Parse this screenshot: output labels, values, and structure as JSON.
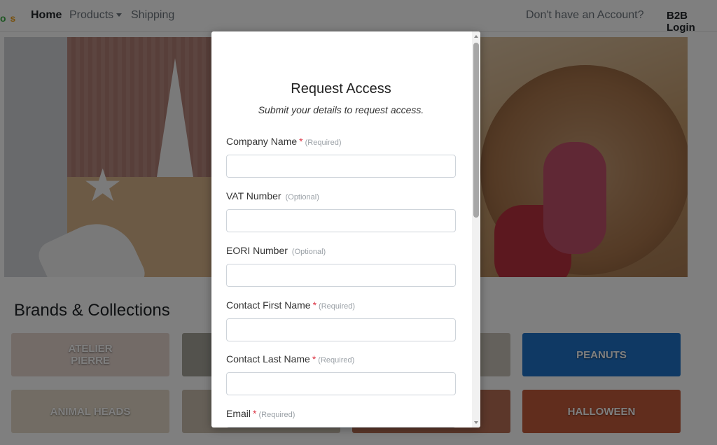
{
  "nav": {
    "logo_o": "o",
    "logo_s": "s",
    "home": "Home",
    "products": "Products",
    "shipping": "Shipping",
    "no_account": "Don't have an Account?",
    "login": "B2B Login"
  },
  "brands": {
    "title": "Brands & Collections",
    "tiles": [
      {
        "label": "ATELIER\nPIERRE",
        "color": "#e6d6cf"
      },
      {
        "label": "",
        "color": "#a7a59b"
      },
      {
        "label": "",
        "color": "#c9c3b8"
      },
      {
        "label": "PEANUTS",
        "color": "#1f73c9"
      },
      {
        "label": "ANIMAL HEADS",
        "color": "#e4d9c8"
      },
      {
        "label": "",
        "color": "#cbbfae"
      },
      {
        "label": "",
        "color": "#b96e55"
      },
      {
        "label": "HALLOWEEN",
        "color": "#c35a3a"
      }
    ]
  },
  "modal": {
    "title": "Request Access",
    "subtitle": "Submit your details to request access.",
    "fields": [
      {
        "label": "Company Name",
        "required": "*",
        "hint": "(Required)"
      },
      {
        "label": "VAT Number",
        "required": "",
        "hint": "(Optional)"
      },
      {
        "label": "EORI Number",
        "required": "",
        "hint": "(Optional)"
      },
      {
        "label": "Contact First Name",
        "required": "*",
        "hint": "(Required)"
      },
      {
        "label": "Contact Last Name",
        "required": "*",
        "hint": "(Required)"
      },
      {
        "label": "Email",
        "required": "*",
        "hint": "(Required)"
      }
    ]
  },
  "colors": {
    "overlay": "rgba(0,0,0,0.5)",
    "required": "#dc3545",
    "hint": "#9aa0a6"
  }
}
